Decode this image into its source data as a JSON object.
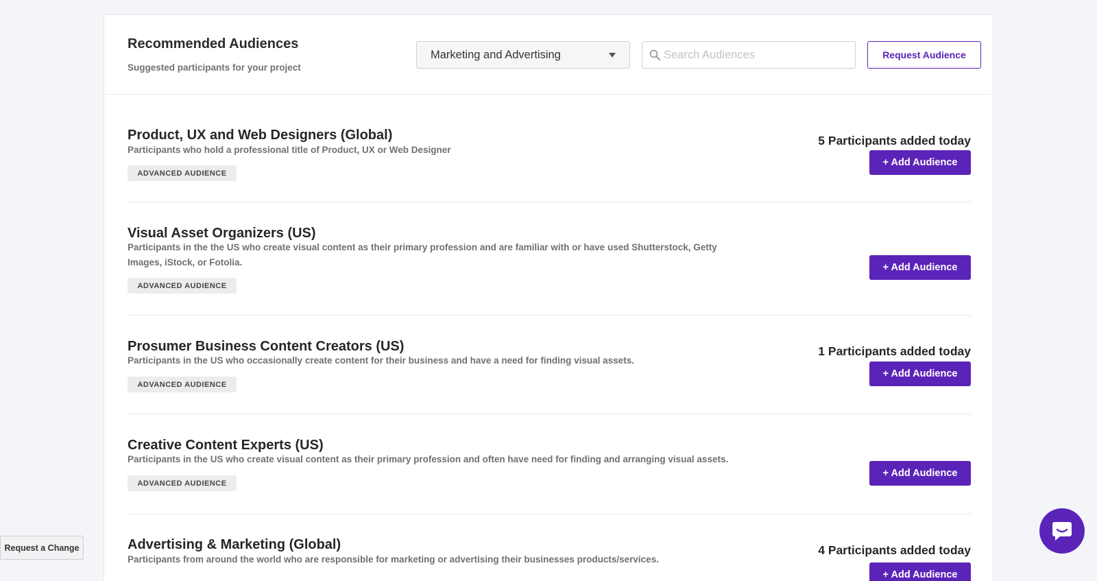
{
  "header": {
    "title": "Recommended Audiences",
    "subtitle": "Suggested participants for your project",
    "category_select": "Marketing and Advertising",
    "search_placeholder": "Search Audiences",
    "request_label": "Request Audience"
  },
  "audiences": [
    {
      "title": "Product, UX and Web Designers (Global)",
      "description": "Participants who hold a professional title of Product, UX or Web Designer",
      "badge": "ADVANCED AUDIENCE",
      "count_text": "5 Participants added today",
      "add_label": "+ Add Audience"
    },
    {
      "title": "Visual Asset Organizers (US)",
      "description": "Participants in the the US who create visual content as their primary profession and are familiar with or have used Shutterstock, Getty Images, iStock, or Fotolia.",
      "badge": "ADVANCED AUDIENCE",
      "count_text": "",
      "add_label": "+ Add Audience"
    },
    {
      "title": "Prosumer Business Content Creators (US)",
      "description": "Participants in the US who occasionally create content for their business and have a need for finding visual assets.",
      "badge": "ADVANCED AUDIENCE",
      "count_text": "1 Participants added today",
      "add_label": "+ Add Audience"
    },
    {
      "title": "Creative Content Experts (US)",
      "description": "Participants in the US who create visual content as their primary profession and often have need for finding and arranging visual assets.",
      "badge": "ADVANCED AUDIENCE",
      "count_text": "",
      "add_label": "+ Add Audience"
    },
    {
      "title": "Advertising & Marketing (Global)",
      "description": "Participants from around the world who are responsible for marketing or advertising their businesses products/services.",
      "badge": "",
      "count_text": "4 Participants added today",
      "add_label": "+ Add Audience"
    }
  ],
  "footer": {
    "request_change_label": "Request a Change"
  },
  "icons": {
    "search": "search-icon",
    "dropdown": "caret-down-icon",
    "chat": "chat-bubble-icon"
  },
  "colors": {
    "accent": "#5b24b8",
    "background": "#f4f5f9"
  }
}
